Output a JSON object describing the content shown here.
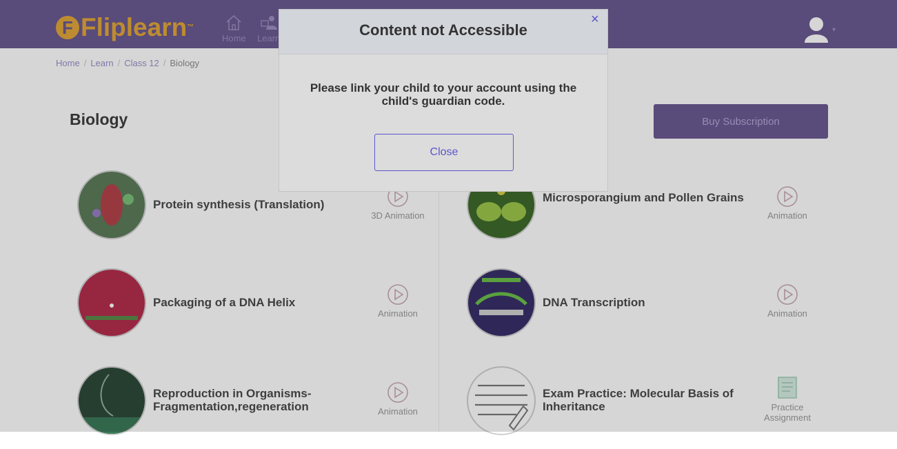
{
  "header": {
    "logo_text": "Fliplearn",
    "logo_letter": "F",
    "logo_mark": "™",
    "nav": [
      {
        "label": "Home",
        "icon": "home-icon"
      },
      {
        "label": "Learn",
        "icon": "learn-icon"
      }
    ],
    "avatar_icon": "user-avatar-icon",
    "caret_icon": "chevron-down-icon"
  },
  "breadcrumb": {
    "items": [
      "Home",
      "Learn",
      "Class 12",
      "Biology"
    ],
    "separator": "/"
  },
  "page": {
    "title": "Biology",
    "buy_label": "Buy Subscription"
  },
  "content": {
    "items": [
      {
        "title": "Protein synthesis (Translation)",
        "action": "3D Animation",
        "icon": "play-icon"
      },
      {
        "title": "Microsporangium and Pollen Grains",
        "action": "Animation",
        "icon": "play-icon"
      },
      {
        "title": "Packaging of a DNA Helix",
        "action": "Animation",
        "icon": "play-icon"
      },
      {
        "title": "DNA Transcription",
        "action": "Animation",
        "icon": "play-icon"
      },
      {
        "title": "Reproduction in Organisms- Fragmentation,regeneration",
        "action": "Animation",
        "icon": "play-icon"
      },
      {
        "title": "Exam Practice: Molecular Basis of Inheritance",
        "action": "Practice Assignment",
        "icon": "assignment-icon"
      }
    ]
  },
  "modal": {
    "title": "Content not Accessible",
    "close_icon": "×",
    "message": "Please link your child to your account using the child's guardian code.",
    "close_button": "Close"
  },
  "colors": {
    "header": "#6b5a92",
    "logo": "#e3a73a",
    "accent": "#5b55c8"
  }
}
